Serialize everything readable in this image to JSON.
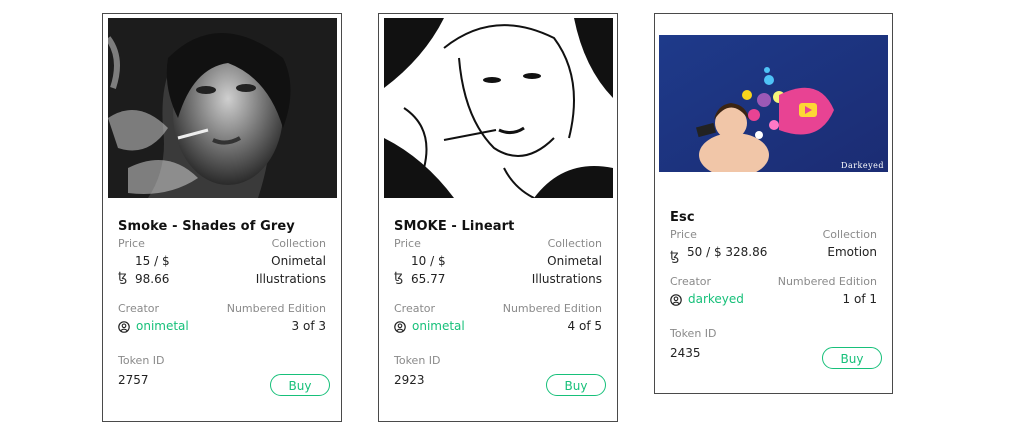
{
  "cards": [
    {
      "title": "Smoke - Shades of Grey",
      "price_label": "Price",
      "price_line1": "15 / $",
      "price_line2": "98.66",
      "collection_label": "Collection",
      "collection_line1": "Onimetal",
      "collection_line2": "Illustrations",
      "creator_label": "Creator",
      "creator": "onimetal",
      "edition_label": "Numbered Edition",
      "edition": "3 of 3",
      "token_label": "Token ID",
      "token": "2757",
      "buy_label": "Buy"
    },
    {
      "title": "SMOKE - Lineart",
      "price_label": "Price",
      "price_line1": "10 / $",
      "price_line2": "65.77",
      "collection_label": "Collection",
      "collection_line1": "Onimetal",
      "collection_line2": "Illustrations",
      "creator_label": "Creator",
      "creator": "onimetal",
      "edition_label": "Numbered Edition",
      "edition": "4 of 5",
      "token_label": "Token ID",
      "token": "2923",
      "buy_label": "Buy"
    },
    {
      "title": "Esc",
      "price_label": "Price",
      "price_line1": "50 / $ 328.86",
      "collection_label": "Collection",
      "collection_line1": "Emotion",
      "creator_label": "Creator",
      "creator": "darkeyed",
      "edition_label": "Numbered Edition",
      "edition": "1 of 1",
      "token_label": "Token ID",
      "token": "2435",
      "buy_label": "Buy",
      "image_signature": "Darkeyed"
    }
  ],
  "currency_symbol": "ꜩ",
  "colors": {
    "accent": "#17c07a",
    "border": "#4a4a4a",
    "label": "#8a8a8a"
  }
}
